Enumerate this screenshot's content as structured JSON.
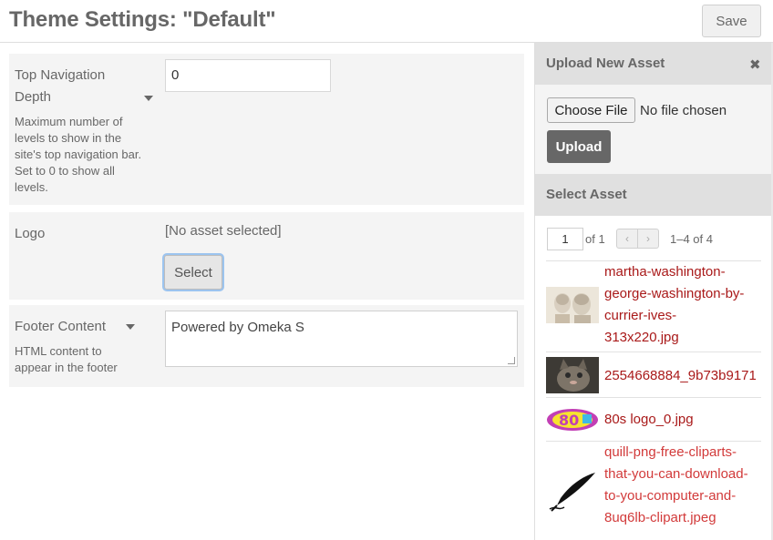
{
  "header": {
    "title": "Theme Settings: \"Default\"",
    "save_label": "Save"
  },
  "fields": {
    "nav_depth": {
      "label_line1": "Top Navigation",
      "label_line2": "Depth",
      "desc_lines": [
        "Maximum number of",
        "levels to show in the",
        "site's top navigation bar.",
        "Set to 0 to show all",
        "levels."
      ],
      "value": "0"
    },
    "logo": {
      "label": "Logo",
      "status": "[No asset selected]",
      "select_label": "Select"
    },
    "footer": {
      "label": "Footer Content",
      "desc_lines": [
        "HTML content to",
        "appear in the footer"
      ],
      "value": "Powered by Omeka S"
    }
  },
  "sidebar": {
    "upload_title": "Upload New Asset",
    "choose_label": "Choose File",
    "no_file_text": "No file chosen",
    "upload_label": "Upload",
    "select_title": "Select Asset",
    "pager": {
      "page": "1",
      "of_text": "of 1",
      "prev": "‹",
      "next": "›",
      "range": "1–4 of 4"
    },
    "assets": [
      {
        "name_lines": [
          "martha-washington-",
          "george-washington-by-",
          "currier-ives-",
          "313x220.jpg"
        ],
        "thumb": "portrait-thumbnail"
      },
      {
        "name_lines": [
          "2554668884_9b73b9171"
        ],
        "thumb": "kitten-thumbnail"
      },
      {
        "name_lines": [
          "80s logo_0.jpg"
        ],
        "thumb": "80s-logo-thumbnail"
      },
      {
        "name_lines": [
          "quill-png-free-cliparts-",
          "that-you-can-download-",
          "to-you-computer-and-",
          "8uq6lb-clipart.jpeg"
        ],
        "thumb": "quill-thumbnail"
      }
    ]
  },
  "colors": {
    "link": "#a91919",
    "link_light": "#d23a3a",
    "text": "#676767",
    "panel_bg": "#f4f4f4"
  }
}
